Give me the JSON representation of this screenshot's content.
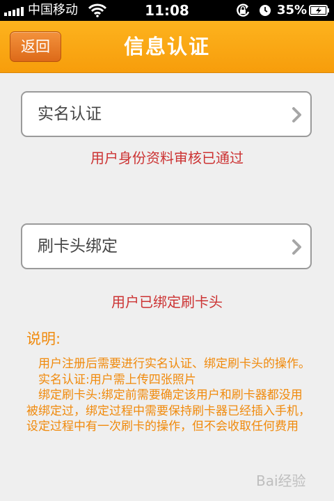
{
  "status_bar": {
    "carrier": "中国移动",
    "time": "11:08",
    "battery": "35%"
  },
  "nav": {
    "back_label": "返回",
    "title": "信息认证"
  },
  "menu": [
    {
      "label": "实名认证",
      "status": "用户身份资料审核已通过"
    },
    {
      "label": "刷卡头绑定",
      "status": "用户已绑定刷卡头"
    }
  ],
  "notes": {
    "heading": "说明:",
    "paragraphs": [
      "　用户注册后需要进行实名认证、绑定刷卡头的操作。",
      "　实名认证:用户需上传四张照片",
      "　绑定刷卡头:绑定前需要确定该用户和刷卡器都没用被绑定过，绑定过程中需要保持刷卡器已经插入手机，设定过程中有一次刷卡的操作，但不会收取任何费用"
    ]
  },
  "watermark": {
    "text": "Bai经验"
  },
  "colors": {
    "nav_orange": "#f9a411",
    "back_button": "#e5772a",
    "status_red": "#cc3333",
    "notes_orange": "#f08a0c",
    "background": "#efefef"
  }
}
